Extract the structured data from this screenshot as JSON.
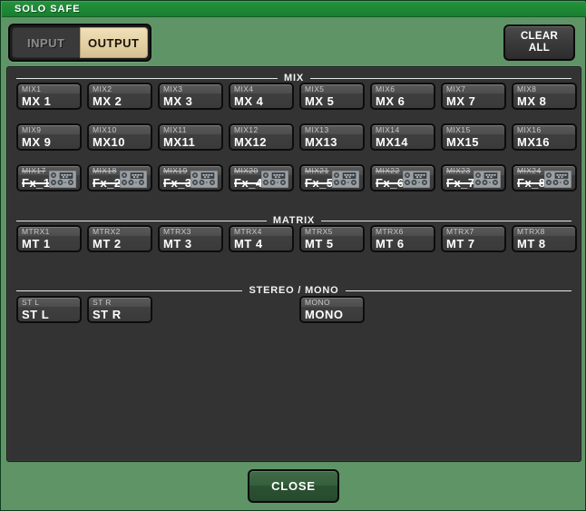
{
  "window": {
    "title": "SOLO SAFE"
  },
  "tabs": [
    {
      "label": "INPUT",
      "state": "inactive"
    },
    {
      "label": "OUTPUT",
      "state": "active"
    }
  ],
  "clear_all_button": {
    "line1": "CLEAR",
    "line2": "ALL"
  },
  "close_button": {
    "label": "CLOSE"
  },
  "groups": {
    "mix": {
      "header": "MIX",
      "rows": [
        [
          {
            "top": "MIX1",
            "name": "MX 1",
            "struck": false,
            "icon": null
          },
          {
            "top": "MIX2",
            "name": "MX 2",
            "struck": false,
            "icon": null
          },
          {
            "top": "MIX3",
            "name": "MX 3",
            "struck": false,
            "icon": null
          },
          {
            "top": "MIX4",
            "name": "MX 4",
            "struck": false,
            "icon": null
          },
          {
            "top": "MIX5",
            "name": "MX 5",
            "struck": false,
            "icon": null
          },
          {
            "top": "MIX6",
            "name": "MX 6",
            "struck": false,
            "icon": null
          },
          {
            "top": "MIX7",
            "name": "MX 7",
            "struck": false,
            "icon": null
          },
          {
            "top": "MIX8",
            "name": "MX 8",
            "struck": false,
            "icon": null
          }
        ],
        [
          {
            "top": "MIX9",
            "name": "MX 9",
            "struck": false,
            "icon": null
          },
          {
            "top": "MIX10",
            "name": "MX10",
            "struck": false,
            "icon": null
          },
          {
            "top": "MIX11",
            "name": "MX11",
            "struck": false,
            "icon": null
          },
          {
            "top": "MIX12",
            "name": "MX12",
            "struck": false,
            "icon": null
          },
          {
            "top": "MIX13",
            "name": "MX13",
            "struck": false,
            "icon": null
          },
          {
            "top": "MIX14",
            "name": "MX14",
            "struck": false,
            "icon": null
          },
          {
            "top": "MIX15",
            "name": "MX15",
            "struck": false,
            "icon": null
          },
          {
            "top": "MIX16",
            "name": "MX16",
            "struck": false,
            "icon": null
          }
        ],
        [
          {
            "top": "MIX17",
            "name": "Fx_1",
            "struck": true,
            "icon": "effect-rack-icon"
          },
          {
            "top": "MIX18",
            "name": "Fx_2",
            "struck": true,
            "icon": "effect-rack-icon"
          },
          {
            "top": "MIX19",
            "name": "Fx_3",
            "struck": true,
            "icon": "effect-rack-icon"
          },
          {
            "top": "MIX20",
            "name": "Fx_4",
            "struck": true,
            "icon": "effect-rack-icon"
          },
          {
            "top": "MIX21",
            "name": "Fx_5",
            "struck": true,
            "icon": "effect-rack-icon"
          },
          {
            "top": "MIX22",
            "name": "Fx_6",
            "struck": true,
            "icon": "effect-rack-icon"
          },
          {
            "top": "MIX23",
            "name": "Fx_7",
            "struck": true,
            "icon": "effect-rack-icon"
          },
          {
            "top": "MIX24",
            "name": "Fx_8",
            "struck": true,
            "icon": "effect-rack-icon"
          }
        ]
      ]
    },
    "matrix": {
      "header": "MATRIX",
      "rows": [
        [
          {
            "top": "MTRX1",
            "name": "MT 1",
            "struck": false,
            "icon": null
          },
          {
            "top": "MTRX2",
            "name": "MT 2",
            "struck": false,
            "icon": null
          },
          {
            "top": "MTRX3",
            "name": "MT 3",
            "struck": false,
            "icon": null
          },
          {
            "top": "MTRX4",
            "name": "MT 4",
            "struck": false,
            "icon": null
          },
          {
            "top": "MTRX5",
            "name": "MT 5",
            "struck": false,
            "icon": null
          },
          {
            "top": "MTRX6",
            "name": "MT 6",
            "struck": false,
            "icon": null
          },
          {
            "top": "MTRX7",
            "name": "MT 7",
            "struck": false,
            "icon": null
          },
          {
            "top": "MTRX8",
            "name": "MT 8",
            "struck": false,
            "icon": null
          }
        ]
      ]
    },
    "stereo_mono": {
      "header": "STEREO / MONO",
      "rows": [
        [
          {
            "top": "ST L",
            "name": "ST L",
            "struck": false,
            "icon": null
          },
          {
            "top": "ST R",
            "name": "ST R",
            "struck": false,
            "icon": null
          },
          {
            "top": "MONO",
            "name": "MONO",
            "struck": false,
            "icon": null,
            "offset": 156
          }
        ]
      ]
    }
  },
  "colors": {
    "window_background": "#5f9467",
    "titlebar": "#1f8a36",
    "panel": "#333333",
    "active_tab": "#e2cfa2",
    "button_face": "#4d4d4d",
    "close_button": "#35603c"
  }
}
